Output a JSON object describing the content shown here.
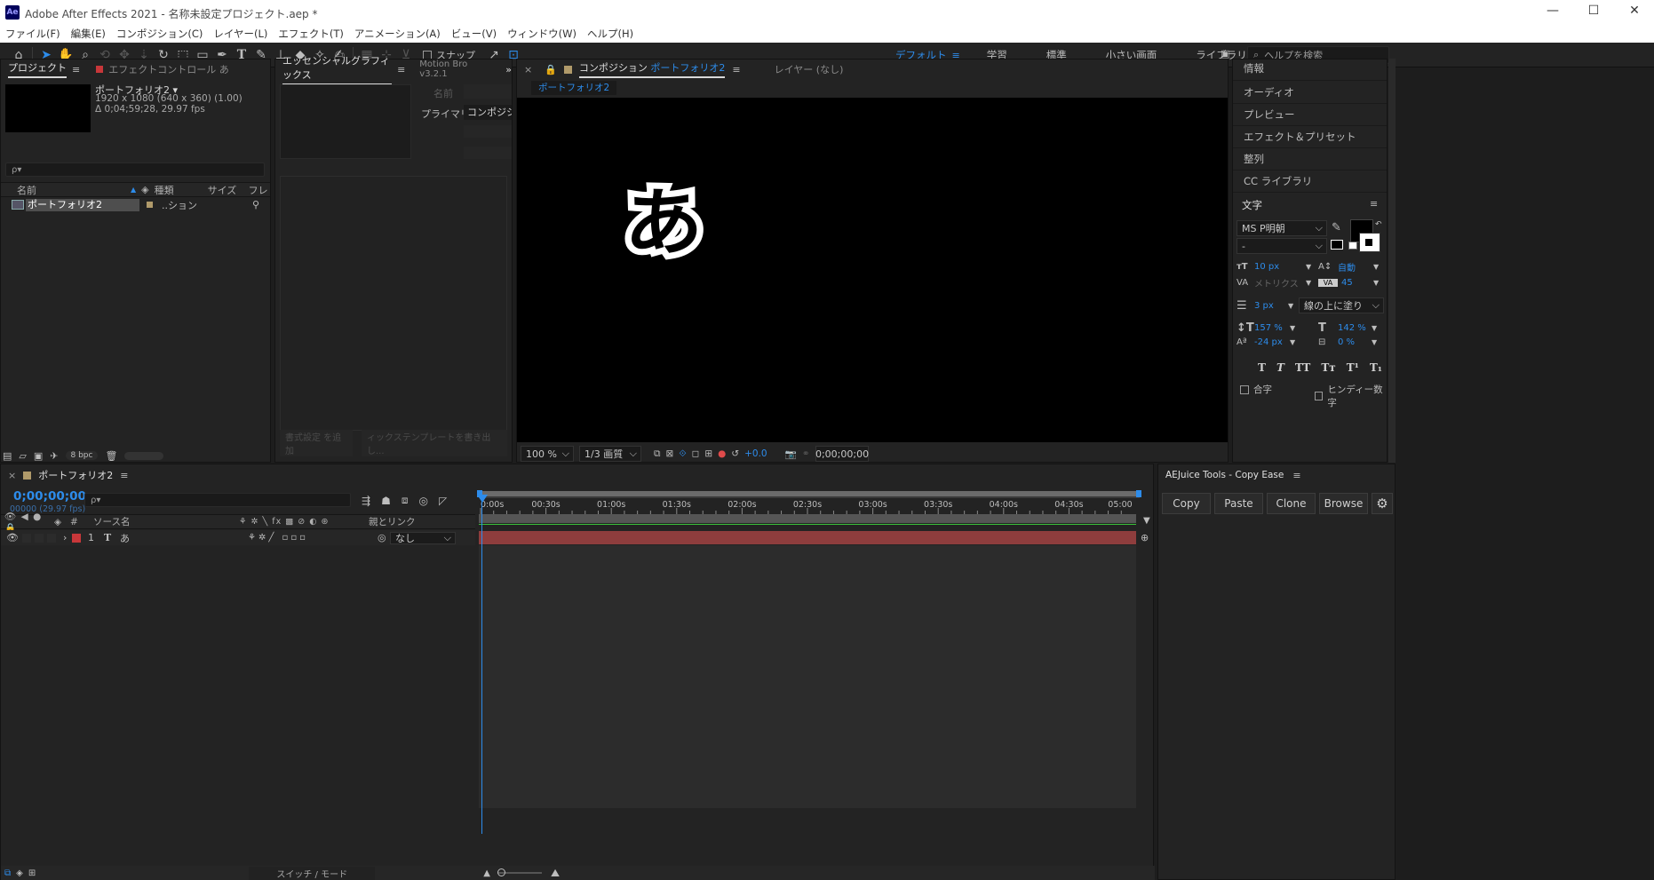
{
  "window": {
    "app_logo": "Ae",
    "title": "Adobe After Effects 2021 - 名称未設定プロジェクト.aep *",
    "controls": [
      "—",
      "☐",
      "✕"
    ]
  },
  "menu": [
    "ファイル(F)",
    "編集(E)",
    "コンポジション(C)",
    "レイヤー(L)",
    "エフェクト(T)",
    "アニメーション(A)",
    "ビュー(V)",
    "ウィンドウ(W)",
    "ヘルプ(H)"
  ],
  "toolbar": {
    "snap_label": "スナップ",
    "workspaces": [
      "デフォルト",
      "学習",
      "標準",
      "小さい画面",
      "ライブラリ"
    ],
    "active_workspace": "デフォルト",
    "more": "»",
    "help_search_placeholder": "ヘルプを検索"
  },
  "project_panel": {
    "tabs": [
      "プロジェクト",
      "エフェクトコントロール あ"
    ],
    "comp_name": "ポートフォリオ2 ▾",
    "comp_info1": "1920 x 1080  (640 x 360) (1.00)",
    "comp_info2": "Δ 0;04;59;28, 29.97 fps",
    "search_placeholder": "ρ▾",
    "columns": [
      "名前",
      "種類",
      "サイズ",
      "フレ"
    ],
    "items": [
      {
        "name": "ポートフォリオ2",
        "type": "..ション"
      }
    ],
    "bpc": "8 bpc"
  },
  "essential_panel": {
    "tabs": [
      "エッセンシャルグラフィックス",
      "Motion Bro v3.2.1"
    ],
    "name_label": "名前",
    "primary_label": "プライマリ:",
    "primary_value": "コンポジショ",
    "footer_left": "書式設定 を追加",
    "footer_right": "ィックステンプレートを書き出し..."
  },
  "comp_panel": {
    "tab_prefix": "コンポジション",
    "tab_name": "ポートフォリオ2",
    "layer_tab": "レイヤー (なし)",
    "breadcrumb": "ポートフォリオ2",
    "canvas_text": "あ",
    "zoom": "100 %",
    "resolution": "1/3 画質",
    "exposure": "+0.0",
    "timecode": "0;00;00;00"
  },
  "right_panels": {
    "items": [
      "情報",
      "オーディオ",
      "プレビュー",
      "エフェクト＆プリセット",
      "整列",
      "CC ライブラリ"
    ],
    "character_title": "文字",
    "font": "MS P明朝",
    "font_style": "-",
    "font_size": "10 px",
    "leading": "自動",
    "kerning": "メトリクス",
    "tracking": "45",
    "stroke_width": "3 px",
    "stroke_mode": "線の上に塗り",
    "vscale": "157 %",
    "hscale": "142 %",
    "baseline": "-24 px",
    "tsume": "0 %",
    "styles": [
      "T",
      "T",
      "TT",
      "Tт",
      "T¹",
      "T₁"
    ],
    "ligature": "合字",
    "hindi": "ヒンディー数字"
  },
  "timeline": {
    "tab_name": "ポートフォリオ2",
    "timecode": "0;00;00;00",
    "frame_info": "00000 (29.97 fps)",
    "search_placeholder": "ρ▾",
    "columns": {
      "source": "ソース名",
      "parent": "親とリンク"
    },
    "layer": {
      "index": "1",
      "type_icon": "T",
      "name": "あ",
      "parent": "なし"
    },
    "ruler": [
      "0:00s",
      "00:30s",
      "01:00s",
      "01:30s",
      "02:00s",
      "02:30s",
      "03:00s",
      "03:30s",
      "04:00s",
      "04:30s",
      "05:00"
    ],
    "switches_label": "スイッチ / モード"
  },
  "aejuice": {
    "title": "AEJuice Tools - Copy Ease",
    "buttons": [
      "Copy",
      "Paste",
      "Clone",
      "Browse"
    ]
  },
  "colors": {
    "accent": "#2d8ceb",
    "layer_bar": "#8e3d3d",
    "layer_label": "#c8373a",
    "panel_bg": "#232323"
  }
}
